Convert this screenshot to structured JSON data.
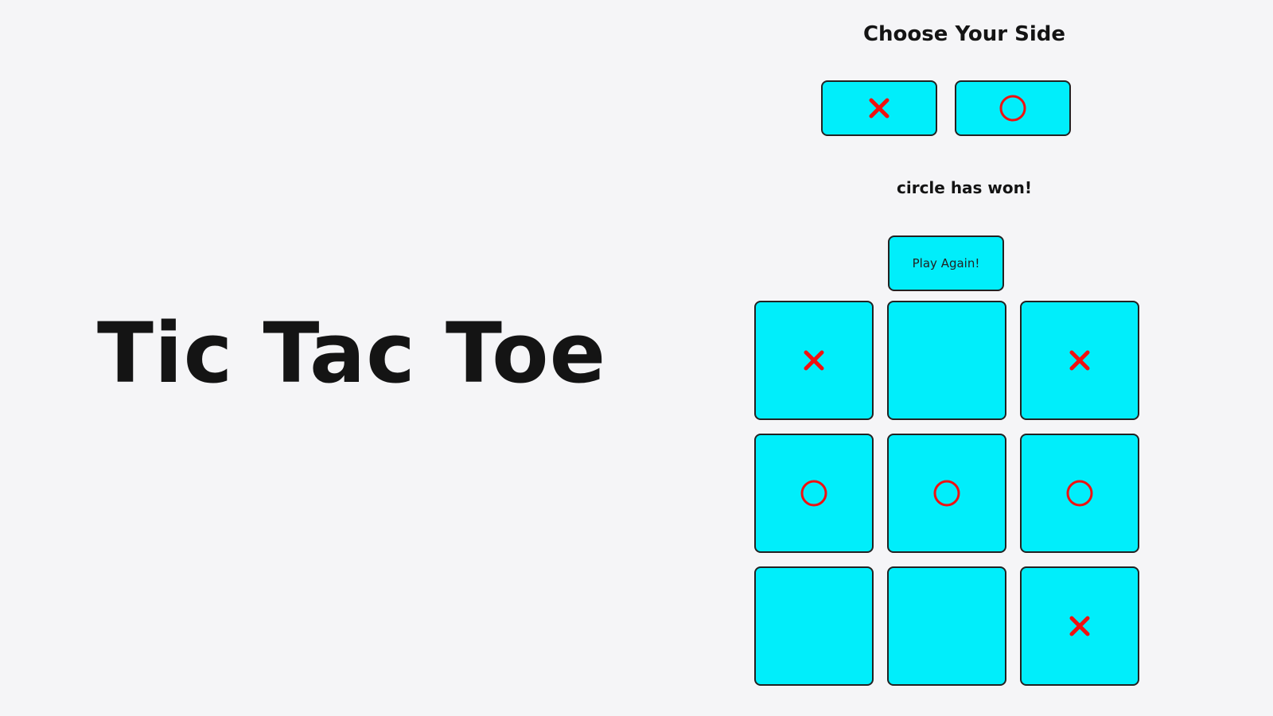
{
  "title": "Tic Tac Toe",
  "side_picker": {
    "heading": "Choose Your Side",
    "options": [
      {
        "symbol": "cross",
        "icon": "cross-icon"
      },
      {
        "symbol": "circle",
        "icon": "circle-icon"
      }
    ]
  },
  "status_message": "circle has won!",
  "play_again_label": "Play Again!",
  "board": {
    "cells": [
      "cross",
      "",
      "cross",
      "circle",
      "circle",
      "circle",
      "",
      "",
      "cross"
    ]
  },
  "colors": {
    "tile": "#00eefb",
    "mark": "#f01010",
    "border": "#222222"
  }
}
